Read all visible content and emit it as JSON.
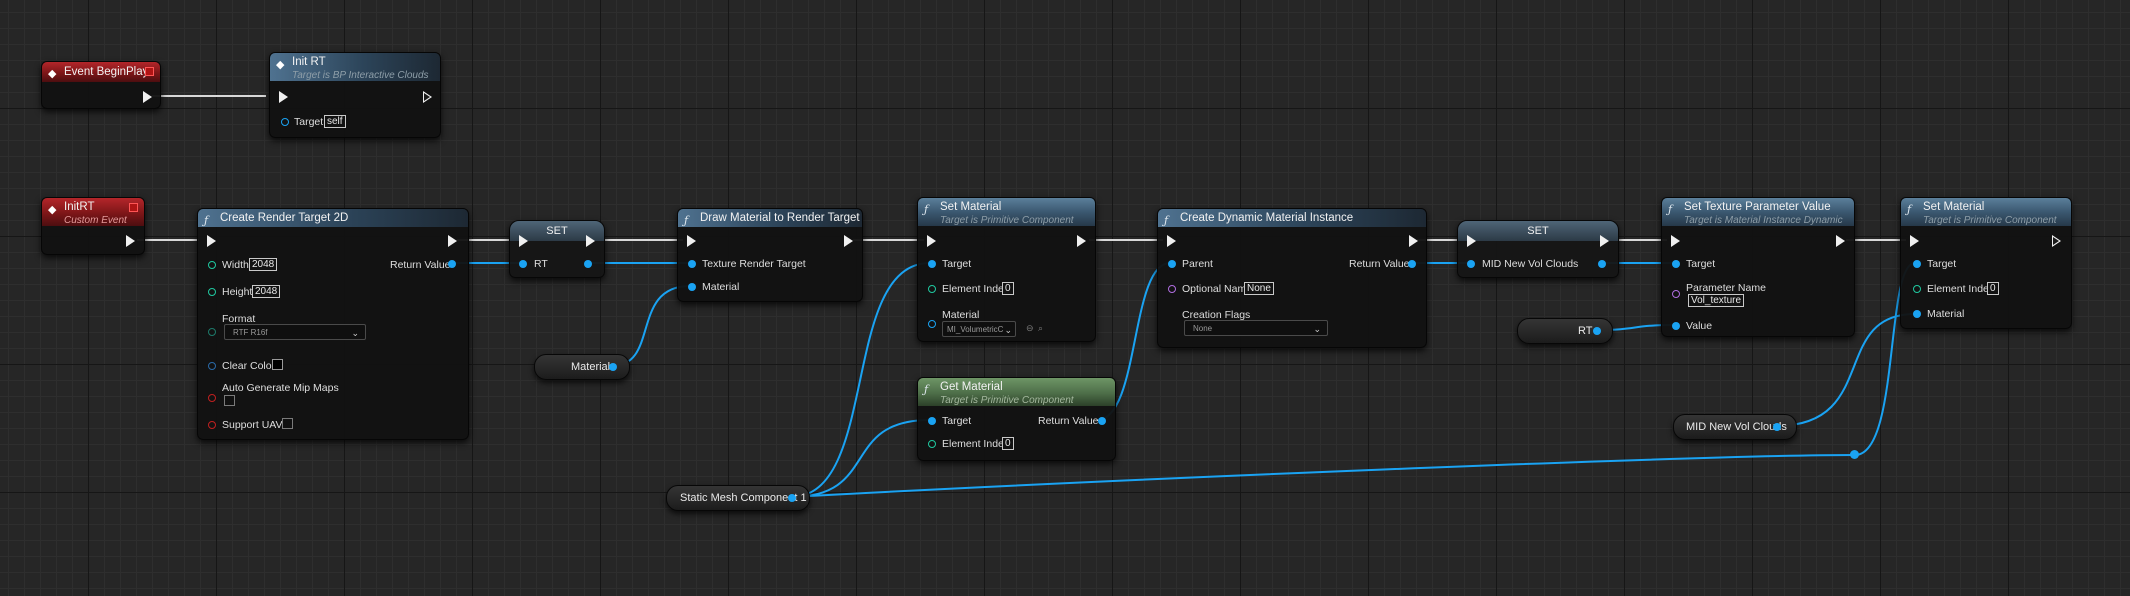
{
  "colors": {
    "wire_object": "#1aa3f3",
    "wire_exec": "#e6e6e6",
    "graph_background": "#262626",
    "event_header": "#8e1c1f",
    "function_header": "#3b5870",
    "pure_function_header": "#4d6e48"
  },
  "icons": {
    "event": "event-diamond-icon",
    "function": "function-f-icon",
    "delegate": "delegate-square-icon",
    "exec_pin": "exec-arrow-icon",
    "data_pin": "data-circle-icon"
  },
  "nodes": {
    "event_begin_play": {
      "title": "Event BeginPlay"
    },
    "init_rt_call": {
      "title": "Init RT",
      "subtitle": "Target is BP Interactive Clouds",
      "target_label": "Target",
      "target_value": "self"
    },
    "init_rt_event": {
      "title": "InitRT",
      "subtitle": "Custom Event"
    },
    "create_rt": {
      "title": "Create Render Target 2D",
      "width_label": "Width",
      "width_value": "2048",
      "height_label": "Height",
      "height_value": "2048",
      "format_label": "Format",
      "format_value": "RTF R16f",
      "clear_color_label": "Clear Color",
      "mips_label": "Auto Generate Mip Maps",
      "uavs_label": "Support UAVs",
      "return_label": "Return Value"
    },
    "set_rt": {
      "title": "SET",
      "var_label": "RT"
    },
    "draw_material": {
      "title": "Draw Material to Render Target",
      "texture_label": "Texture Render Target",
      "material_label": "Material"
    },
    "material_var": {
      "label": "Material"
    },
    "set_material_1": {
      "title": "Set Material",
      "subtitle": "Target is Primitive Component",
      "target_label": "Target",
      "index_label": "Element Index",
      "index_value": "0",
      "material_label": "Material",
      "material_value": "MI_VolumetricC"
    },
    "get_material": {
      "title": "Get Material",
      "subtitle": "Target is Primitive Component",
      "target_label": "Target",
      "index_label": "Element Index",
      "index_value": "0",
      "return_label": "Return Value"
    },
    "static_mesh_var": {
      "label": "Static Mesh Component 1"
    },
    "create_dmi": {
      "title": "Create Dynamic Material Instance",
      "parent_label": "Parent",
      "optional_name_label": "Optional Name",
      "optional_name_value": "None",
      "flags_label": "Creation Flags",
      "flags_value": "None",
      "return_label": "Return Value"
    },
    "set_mid": {
      "title": "SET",
      "var_label": "MID New Vol Clouds"
    },
    "rt_var": {
      "label": "RT"
    },
    "set_texture_param": {
      "title": "Set Texture Parameter Value",
      "subtitle": "Target is Material Instance Dynamic",
      "target_label": "Target",
      "param_label": "Parameter Name",
      "param_value": "Vol_texture",
      "value_label": "Value"
    },
    "mid_var": {
      "label": "MID New Vol Clouds"
    },
    "set_material_2": {
      "title": "Set Material",
      "subtitle": "Target is Primitive Component",
      "target_label": "Target",
      "index_label": "Element Index",
      "index_value": "0",
      "material_label": "Material"
    }
  }
}
